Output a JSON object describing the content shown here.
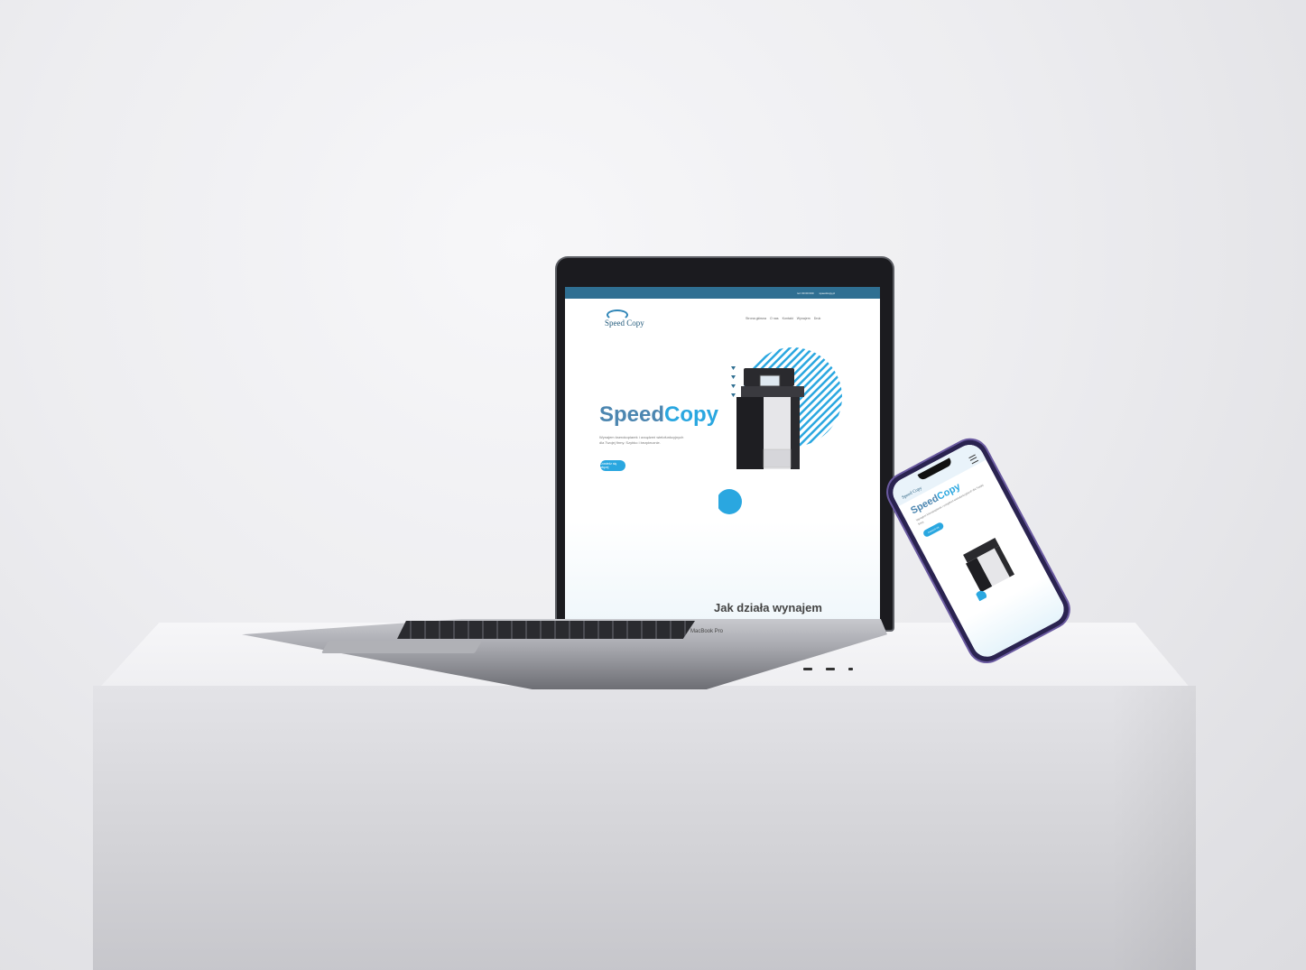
{
  "scene": {
    "laptop_label": "MacBook Pro"
  },
  "site": {
    "topbar": {
      "phone": "tel: 00 00 000",
      "email": "speedcopy.pl"
    },
    "logo_text": "Speed Copy",
    "menu": [
      "Strona główna",
      "O nas",
      "Kontakt",
      "Wynajem",
      "Druk"
    ],
    "hero": {
      "title_part1": "Speed",
      "title_part2": "Copy",
      "subtitle": "Wynajem kserokopiarek i urządzeń wielofunkcyjnych dla Twojej firmy. Szybko i bezpiecznie.",
      "button": "Dowiedz się więcej"
    },
    "section_title": "Jak działa wynajem"
  },
  "phone": {
    "logo_text": "Speed Copy",
    "hero": {
      "title_part1": "Speed",
      "title_part2": "Copy",
      "subtitle": "Wynajem kserokopiarek i urządzeń wielofunkcyjnych dla Twojej firmy.",
      "button": "Dowiedz się"
    }
  },
  "colors": {
    "brand_dark": "#2f6f92",
    "brand_light": "#2aa7e0",
    "title_blue": "#4c86b0"
  }
}
